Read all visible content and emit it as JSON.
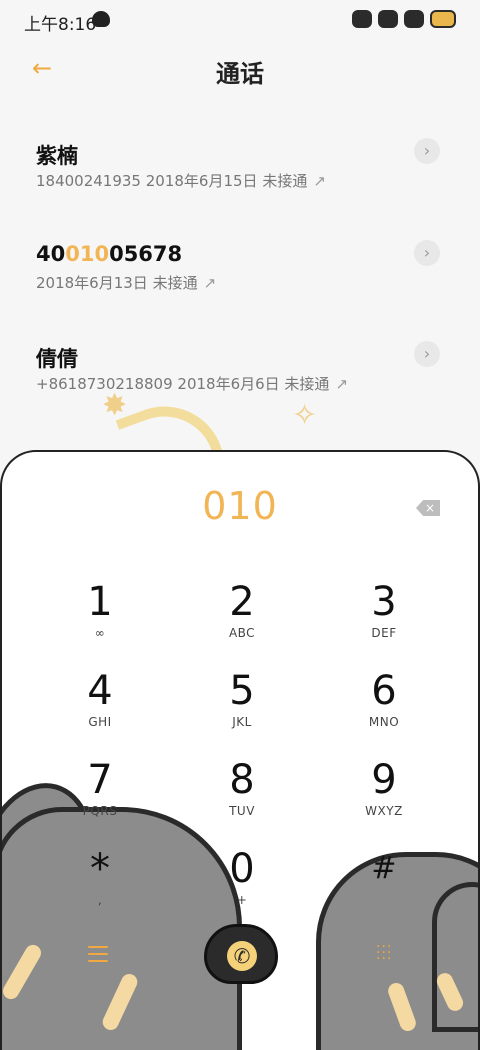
{
  "status": {
    "time": "上午8:16"
  },
  "header": {
    "title": "通话"
  },
  "calls": [
    {
      "name": "紫楠",
      "name_pre": "",
      "name_hl": "",
      "name_post": "",
      "detail": "18400241935 2018年6月15日 未接通"
    },
    {
      "name": "",
      "name_pre": "40",
      "name_hl": "010",
      "name_post": "05678",
      "detail": "2018年6月13日 未接通"
    },
    {
      "name": "倩倩",
      "name_pre": "",
      "name_hl": "",
      "name_post": "",
      "detail": "+8618730218809 2018年6月6日 未接通"
    }
  ],
  "dialpad": {
    "number": "010",
    "keys": [
      {
        "digit": "1",
        "letters": "∞"
      },
      {
        "digit": "2",
        "letters": "ABC"
      },
      {
        "digit": "3",
        "letters": "DEF"
      },
      {
        "digit": "4",
        "letters": "GHI"
      },
      {
        "digit": "5",
        "letters": "JKL"
      },
      {
        "digit": "6",
        "letters": "MNO"
      },
      {
        "digit": "7",
        "letters": "PQRS"
      },
      {
        "digit": "8",
        "letters": "TUV"
      },
      {
        "digit": "9",
        "letters": "WXYZ"
      },
      {
        "digit": "*",
        "letters": ","
      },
      {
        "digit": "0",
        "letters": "+"
      },
      {
        "digit": "#",
        "letters": ""
      }
    ]
  },
  "icons": {
    "back": "back-arrow-icon",
    "chevron": "chevron-right-icon",
    "outgoing": "outgoing-call-arrow-icon",
    "backspace": "backspace-icon",
    "menu": "menu-icon",
    "dialpad_toggle": "dialpad-icon",
    "call": "phone-handset-icon"
  },
  "colors": {
    "accent": "#f0a841",
    "highlight": "#f2b555"
  }
}
